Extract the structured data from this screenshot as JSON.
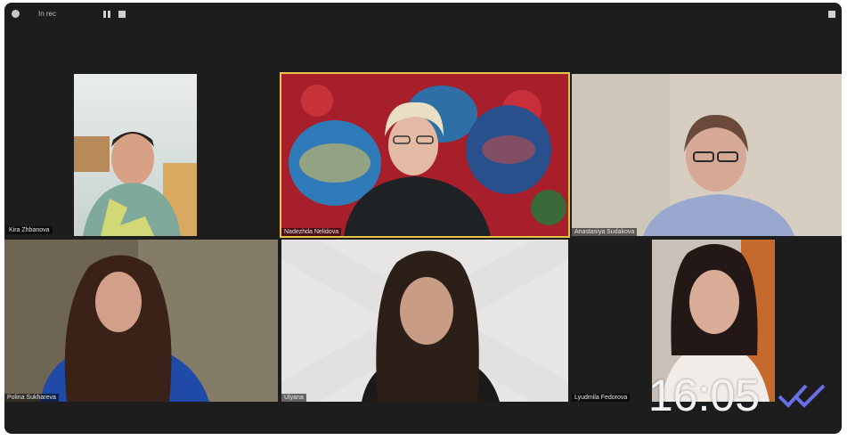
{
  "window": {
    "top_left_text": "In rec",
    "topbar_icons": [
      "record-dot-icon",
      "pause-icon",
      "stop-icon",
      "view-icon"
    ]
  },
  "participants": [
    {
      "name": "Kira Zhbanova",
      "spotlight": false
    },
    {
      "name": "Nadezhda Nelidova",
      "spotlight": true
    },
    {
      "name": "Anastasiya Sudakova",
      "spotlight": false
    },
    {
      "name": "Polina Sukhareva",
      "spotlight": false
    },
    {
      "name": "Ulyana",
      "spotlight": false
    },
    {
      "name": "Lyudmila Fedorova",
      "spotlight": false
    }
  ],
  "overlay": {
    "time": "16:05",
    "read_mark_icon": "double-check-icon",
    "read_mark_color": "#6a6ee8"
  },
  "colors": {
    "background": "#1d1d1d",
    "spotlight_border": "#e5c24c"
  }
}
